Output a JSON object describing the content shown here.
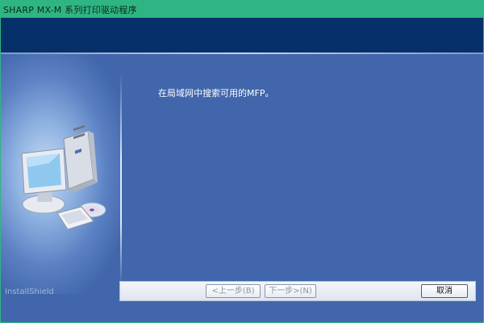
{
  "window": {
    "title": "SHARP MX-M 系列打印驱动程序"
  },
  "main": {
    "message": "在局域网中搜索可用的MFP。"
  },
  "footer": {
    "brand": "InstallShield",
    "back_label": "<上一步(B)",
    "next_label": "下一步>(N)",
    "cancel_label": "取消"
  },
  "colors": {
    "titlebar": "#2fb584",
    "header_band": "#06306a",
    "panel_bg": "#4166ab"
  },
  "icons": {
    "illustration": "computer-with-cd-icon"
  }
}
